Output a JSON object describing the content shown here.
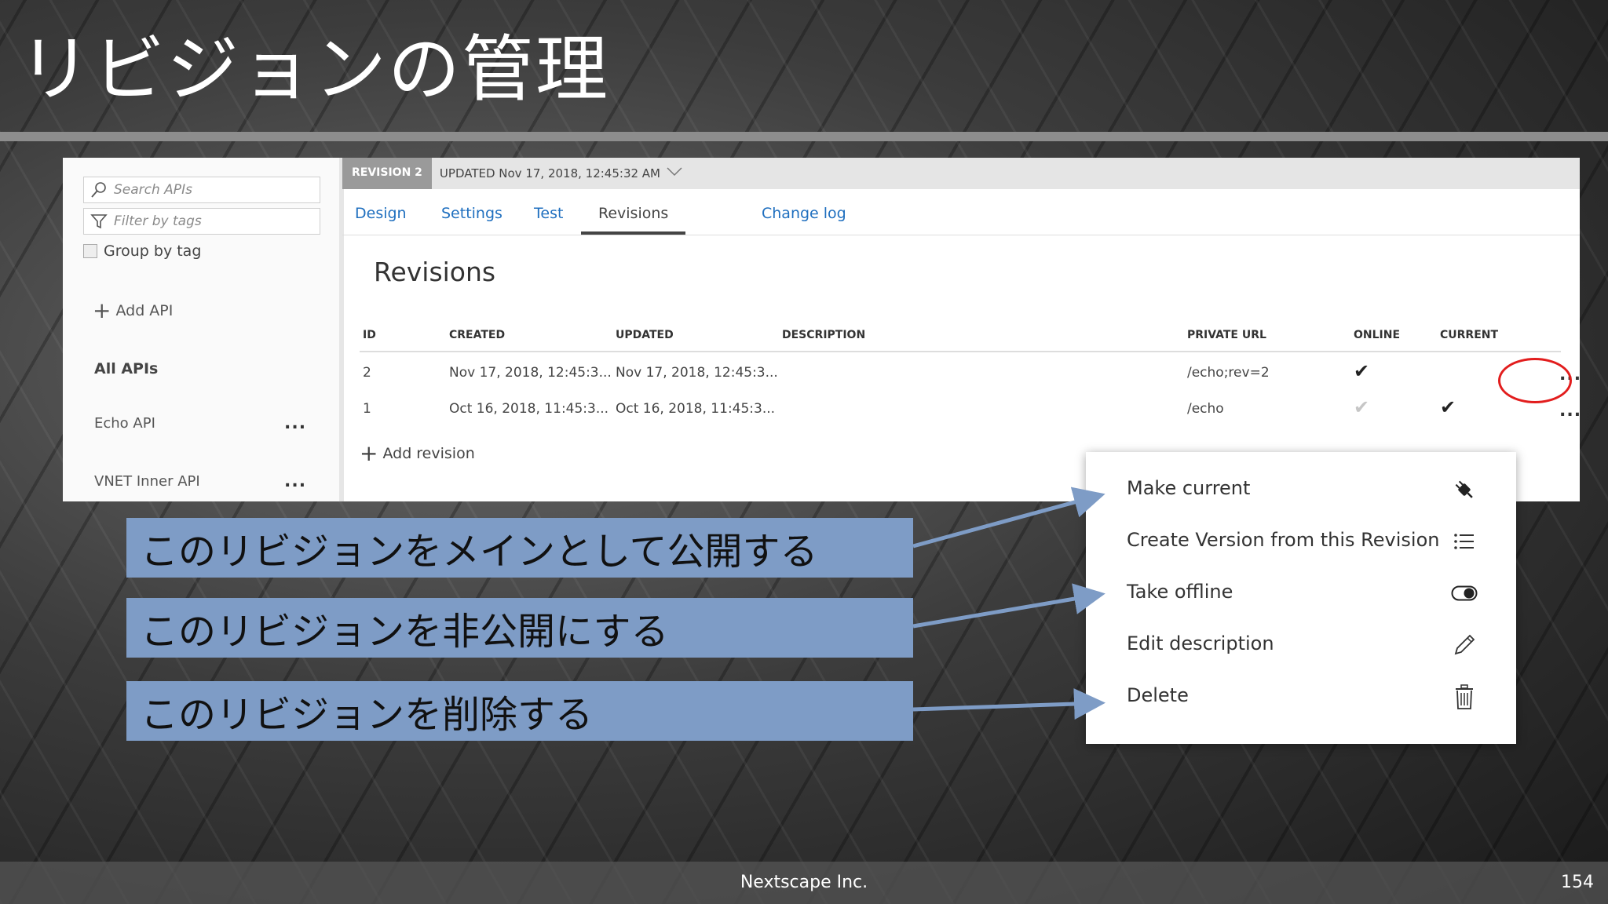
{
  "slide": {
    "title": "リビジョンの管理",
    "footer_company": "Nextscape Inc.",
    "page_number": "154"
  },
  "sidebar": {
    "search_placeholder": "Search APIs",
    "filter_placeholder": "Filter by tags",
    "group_by_tag": "Group by tag",
    "add_api": "Add API",
    "all_apis": "All APIs",
    "apis": [
      {
        "name": "Echo API",
        "more": "..."
      },
      {
        "name": "VNET Inner API",
        "more": "..."
      }
    ]
  },
  "revision_bar": {
    "badge": "REVISION 2",
    "updated": "UPDATED Nov 17, 2018, 12:45:32 AM"
  },
  "tabs": [
    {
      "label": "Design"
    },
    {
      "label": "Settings"
    },
    {
      "label": "Test"
    },
    {
      "label": "Revisions",
      "active": true
    },
    {
      "label": "Change log"
    }
  ],
  "revisions": {
    "title": "Revisions",
    "columns": [
      "ID",
      "CREATED",
      "UPDATED",
      "DESCRIPTION",
      "PRIVATE URL",
      "ONLINE",
      "CURRENT"
    ],
    "rows": [
      {
        "id": "2",
        "created": "Nov 17, 2018, 12:45:3...",
        "updated": "Nov 17, 2018, 12:45:3...",
        "description": "",
        "private_url": "/echo;rev=2",
        "online": true,
        "current": false,
        "more": "..."
      },
      {
        "id": "1",
        "created": "Oct 16, 2018, 11:45:3...",
        "updated": "Oct 16, 2018, 11:45:3...",
        "description": "",
        "private_url": "/echo",
        "online": true,
        "current": true,
        "more": "..."
      }
    ],
    "add_revision": "Add revision"
  },
  "context_menu": {
    "items": [
      {
        "label": "Make current",
        "icon": "plug-icon"
      },
      {
        "label": "Create Version from this Revision",
        "icon": "list-icon"
      },
      {
        "label": "Take offline",
        "icon": "toggle-icon"
      },
      {
        "label": "Edit description",
        "icon": "pencil-icon"
      },
      {
        "label": "Delete",
        "icon": "trash-icon"
      }
    ]
  },
  "callouts": [
    {
      "text": "このリビジョンをメインとして公開する"
    },
    {
      "text": "このリビジョンを非公開にする"
    },
    {
      "text": "このリビジョンを削除する"
    }
  ],
  "colors": {
    "callout_fill": "#7e9cc6",
    "arrow": "#7e9cc6",
    "highlight_circle": "#e21d1d",
    "tab_link": "#1f6fbf"
  }
}
